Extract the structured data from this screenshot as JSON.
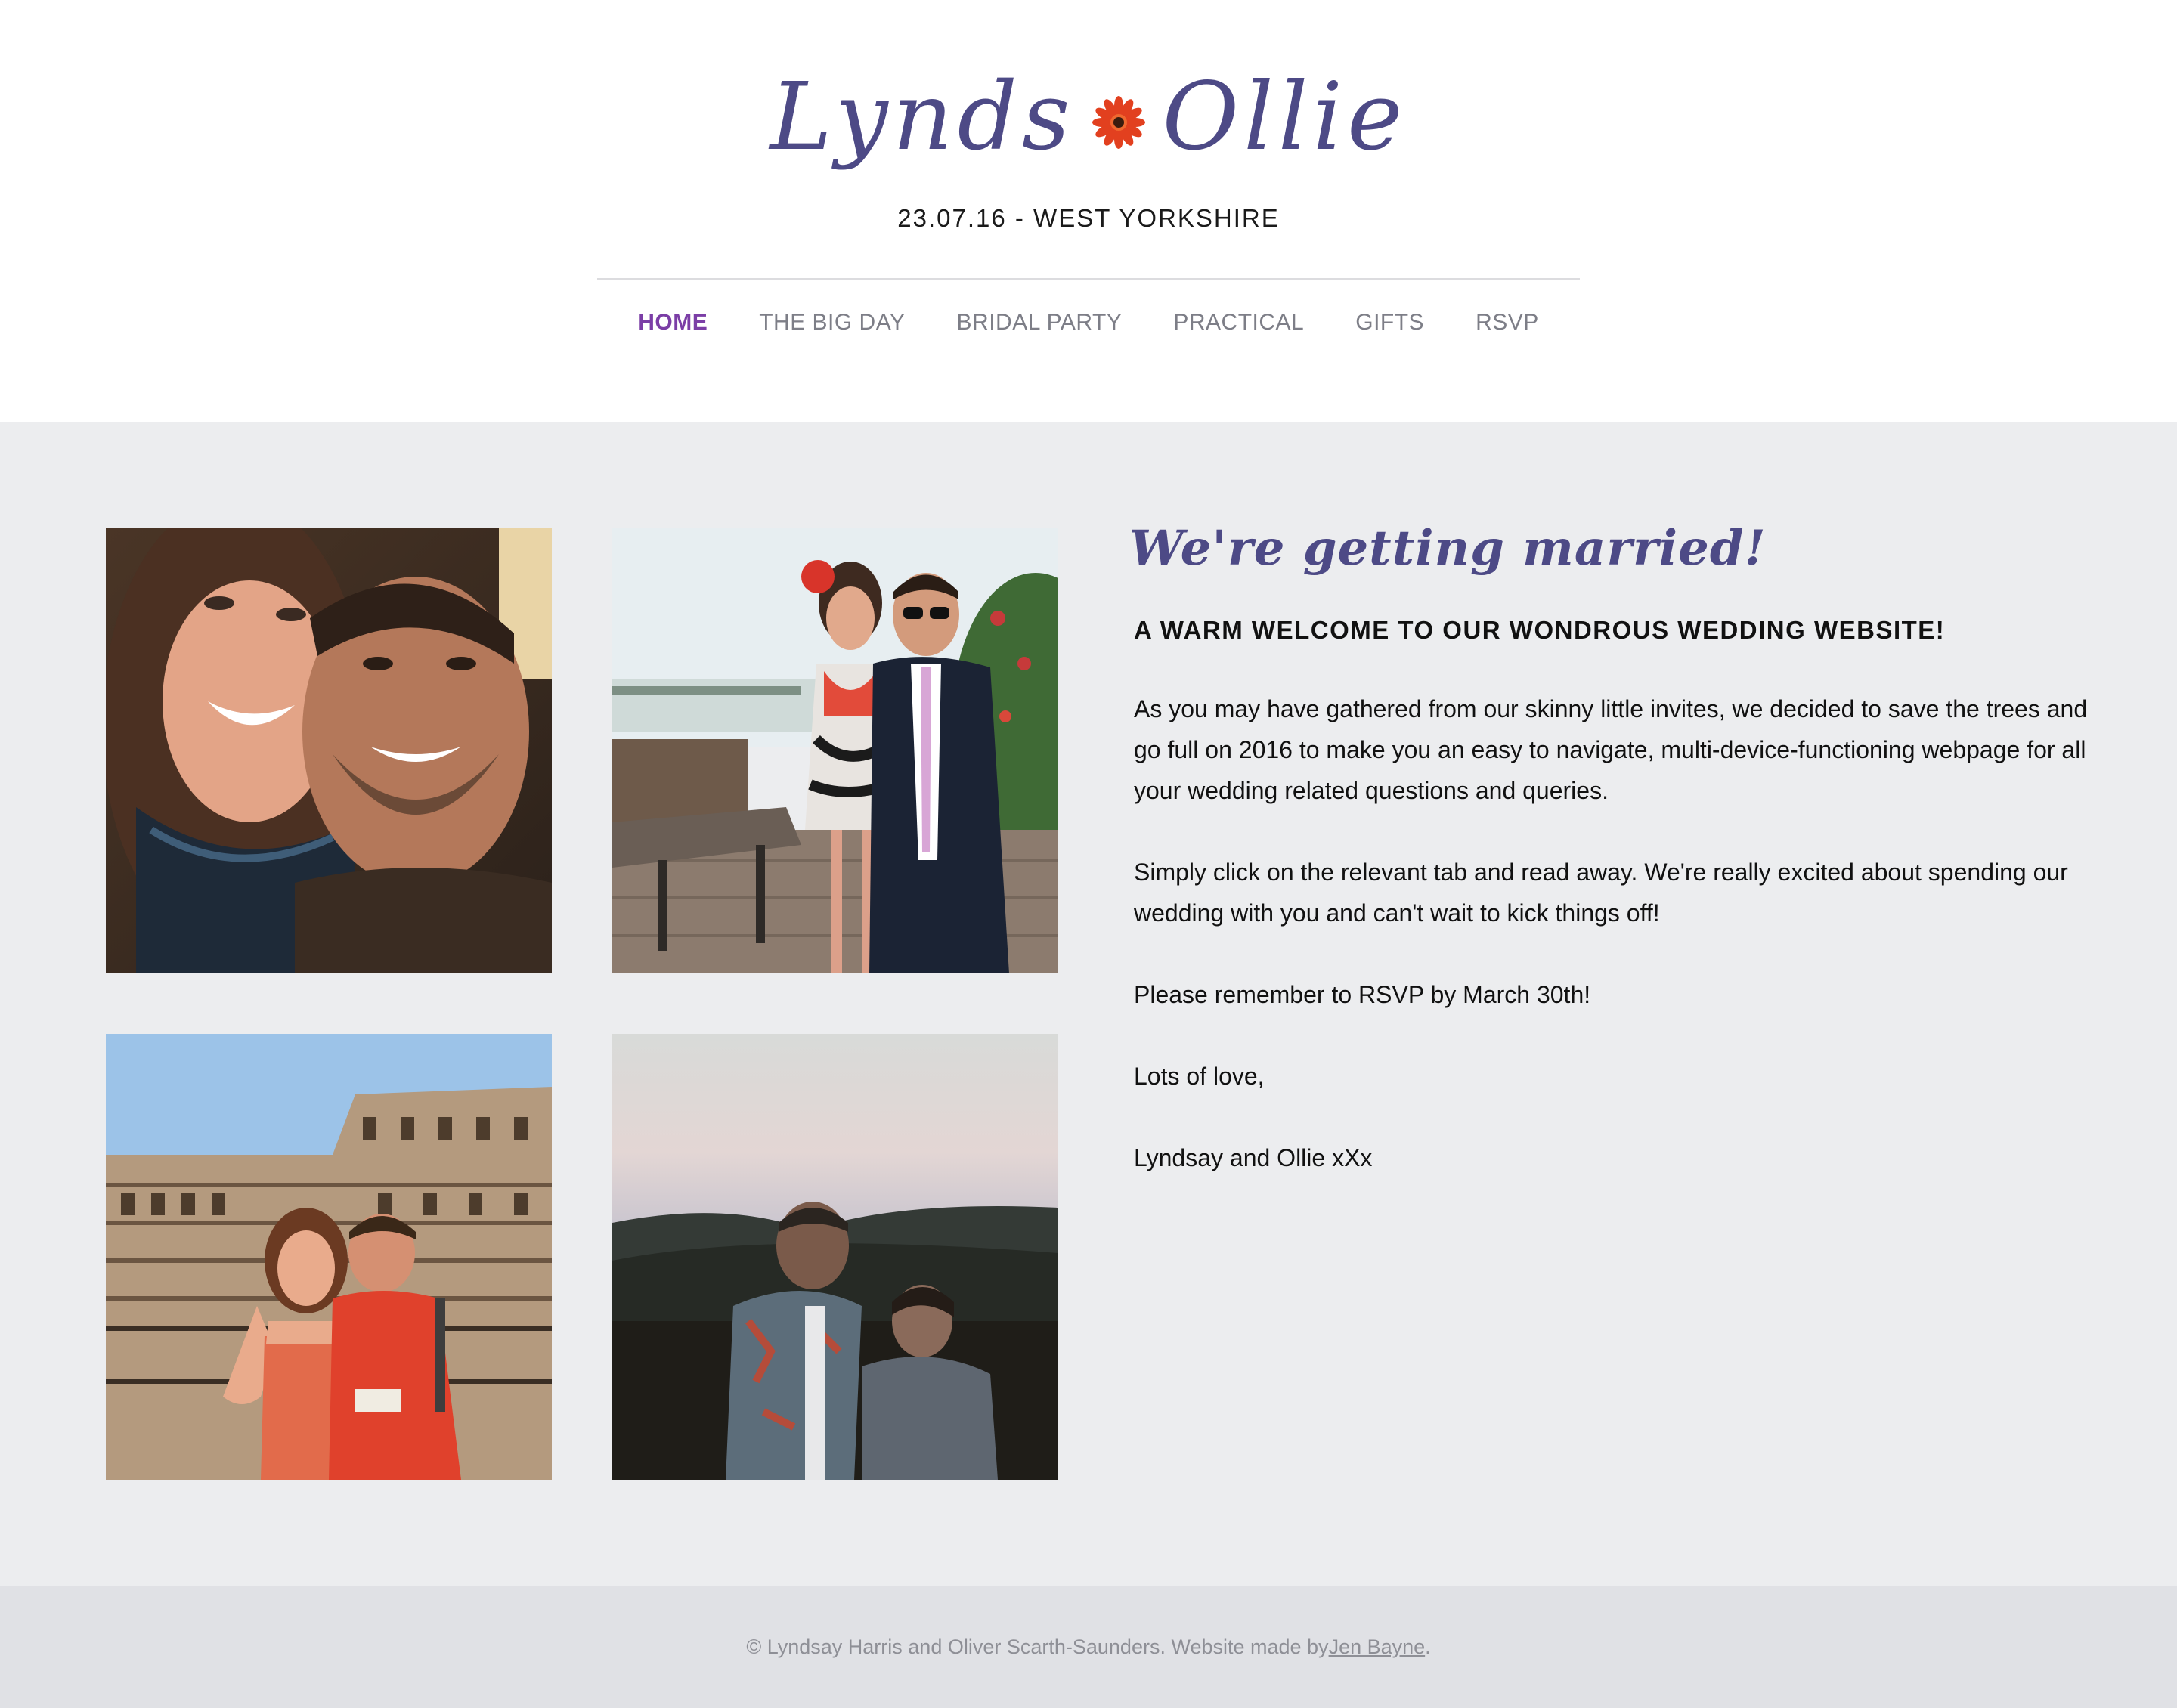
{
  "header": {
    "logo_left": "Lynds",
    "logo_right": "Ollie",
    "logo_flower_icon": "gerbera-flower-icon",
    "tagline": "23.07.16 - WEST YORKSHIRE"
  },
  "nav": {
    "items": [
      {
        "label": "HOME",
        "active": true
      },
      {
        "label": "THE BIG DAY",
        "active": false
      },
      {
        "label": "BRIDAL PARTY",
        "active": false
      },
      {
        "label": "PRACTICAL",
        "active": false
      },
      {
        "label": "GIFTS",
        "active": false
      },
      {
        "label": "RSVP",
        "active": false
      }
    ]
  },
  "main": {
    "heading": "We're getting married!",
    "welcome": "A WARM WELCOME TO OUR WONDROUS WEDDING WEBSITE!",
    "paragraphs": [
      "As you may have gathered from our skinny little invites, we decided to save the trees and go full on 2016 to make you an easy to navigate, multi-device-functioning webpage for all your wedding related questions and queries.",
      "Simply click on the relevant tab and read away. We're really excited about spending our wedding with you and can't wait to kick things off!",
      "Please remember to RSVP by March 30th!",
      "Lots of love,",
      "Lyndsay and Ollie xXx"
    ]
  },
  "footer": {
    "text": "© Lyndsay Harris and Oliver Scarth-Saunders. Website made by ",
    "link": "Jen Bayne",
    "end": "."
  },
  "colors": {
    "brand": "#4d4a86",
    "active_nav": "#7b3ea6",
    "nav": "#7d7e87",
    "main_bg": "#ecedef",
    "footer_bg": "#e0e1e5"
  }
}
